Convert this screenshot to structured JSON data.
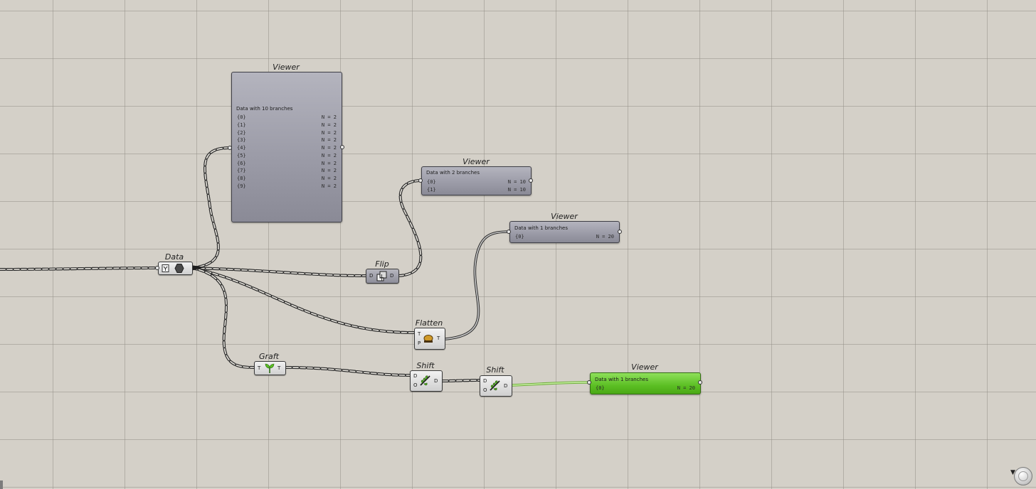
{
  "canvas": {
    "background": "#d4d0c8",
    "wire_color": "#303030",
    "green_wire": "#7fcf3a"
  },
  "viewer_main": {
    "title": "Viewer",
    "header": "Data with 10 branches",
    "rows": [
      {
        "path": "{0}",
        "count": "N = 2"
      },
      {
        "path": "{1}",
        "count": "N = 2"
      },
      {
        "path": "{2}",
        "count": "N = 2"
      },
      {
        "path": "{3}",
        "count": "N = 2"
      },
      {
        "path": "{4}",
        "count": "N = 2"
      },
      {
        "path": "{5}",
        "count": "N = 2"
      },
      {
        "path": "{6}",
        "count": "N = 2"
      },
      {
        "path": "{7}",
        "count": "N = 2"
      },
      {
        "path": "{8}",
        "count": "N = 2"
      },
      {
        "path": "{9}",
        "count": "N = 2"
      }
    ]
  },
  "viewer_flip": {
    "title": "Viewer",
    "header": "Data with 2 branches",
    "rows": [
      {
        "path": "{0}",
        "count": "N = 10"
      },
      {
        "path": "{1}",
        "count": "N = 10"
      }
    ]
  },
  "viewer_flatten": {
    "title": "Viewer",
    "header": "Data with 1 branches",
    "rows": [
      {
        "path": "{0}",
        "count": "N = 20"
      }
    ]
  },
  "viewer_shift": {
    "title": "Viewer",
    "header": "Data with 1 branches",
    "rows": [
      {
        "path": "{0}",
        "count": "N = 20"
      }
    ],
    "color": "#5cbf24"
  },
  "components": {
    "data": {
      "title": "Data",
      "icon": "data-param-icon"
    },
    "flip": {
      "title": "Flip",
      "in": "D",
      "out": "D",
      "icon": "flip-matrix-icon"
    },
    "flatten": {
      "title": "Flatten",
      "in1": "T",
      "in2": "P",
      "out": "T",
      "icon": "flatten-tree-icon"
    },
    "graft": {
      "title": "Graft",
      "in": "T",
      "out": "T",
      "icon": "graft-tree-icon"
    },
    "shift1": {
      "title": "Shift",
      "in1": "D",
      "in2": "O",
      "out": "D",
      "icon": "shift-paths-icon"
    },
    "shift2": {
      "title": "Shift",
      "in1": "D",
      "in2": "O",
      "out": "D",
      "icon": "shift-paths-icon"
    }
  }
}
